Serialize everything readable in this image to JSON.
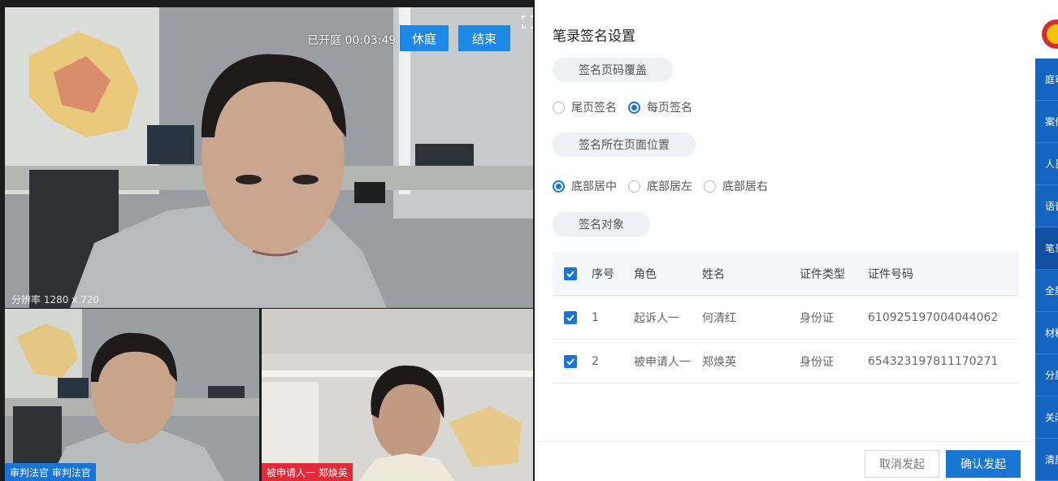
{
  "video": {
    "timer": "已开庭 00:03:49",
    "recess_label": "休庭",
    "end_label": "结束",
    "resolution": "分辨率 1280 x 720",
    "participants": [
      {
        "tag": "审判法官 审判法官",
        "tag_color": "#1a73d6"
      },
      {
        "tag": "被申请人一 郑焕英",
        "tag_color": "#e02b3a"
      }
    ]
  },
  "panel": {
    "title": "笔录签名设置",
    "section_page": "签名页码覆盖",
    "page_options": [
      "尾页签名",
      "每页签名"
    ],
    "page_selected": 1,
    "section_position": "签名所在页面位置",
    "position_options": [
      "底部居中",
      "底部居左",
      "底部居右"
    ],
    "position_selected": 0,
    "section_target": "签名对象",
    "table": {
      "headers": [
        "序号",
        "角色",
        "姓名",
        "证件类型",
        "证件号码"
      ],
      "rows": [
        {
          "no": "1",
          "role": "起诉人一",
          "name": "何清红",
          "id_type": "身份证",
          "id_no": "610925197004044062",
          "checked": true
        },
        {
          "no": "2",
          "role": "被申请人一",
          "name": "郑焕英",
          "id_type": "身份证",
          "id_no": "654323197811170271",
          "checked": true
        }
      ]
    },
    "cancel_label": "取消发起",
    "confirm_label": "确认发起"
  },
  "sidebar": {
    "items": [
      "庭审",
      "案件",
      "人员",
      "语音",
      "笔录",
      "全屏",
      "材料",
      "分屏",
      "关闭",
      "清屏"
    ],
    "active_index": 4
  },
  "colors": {
    "accent": "#1976d2",
    "sidebar": "#1565c0",
    "tag_blue": "#1a73d6",
    "tag_red": "#e02b3a"
  }
}
